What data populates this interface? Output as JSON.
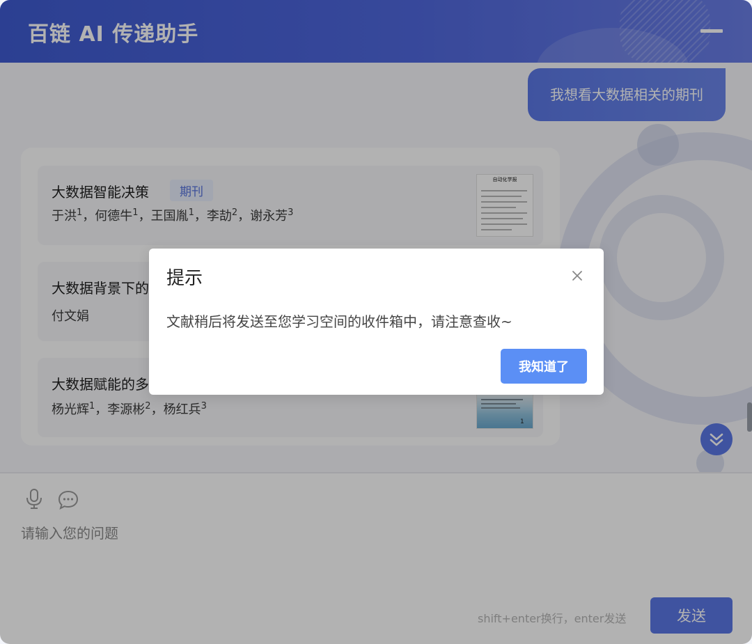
{
  "header": {
    "title": "百链 AI 传递助手",
    "minimize_icon": "minimize-icon"
  },
  "chat": {
    "user_message": "我想看大数据相关的期刊",
    "results": [
      {
        "title": "大数据智能决策",
        "tag": "期刊",
        "authors": [
          {
            "name": "于洪",
            "sup": "1"
          },
          {
            "name": "何德牛",
            "sup": "1"
          },
          {
            "name": "王国胤",
            "sup": "1"
          },
          {
            "name": "李劼",
            "sup": "2"
          },
          {
            "name": "谢永芳",
            "sup": "3"
          }
        ],
        "thumb_header": "自动化学报"
      },
      {
        "title": "大数据背景下的",
        "authors": [
          {
            "name": "付文娟",
            "sup": ""
          }
        ]
      },
      {
        "title": "大数据赋能的多",
        "authors": [
          {
            "name": "杨光辉",
            "sup": "1"
          },
          {
            "name": "李源彬",
            "sup": "2"
          },
          {
            "name": "杨红兵",
            "sup": "3"
          }
        ],
        "thumb_page": "1"
      }
    ],
    "author_separator": "，"
  },
  "input": {
    "placeholder": "请输入您的问题",
    "hint": "shift+enter换行，enter发送",
    "send_label": "发送"
  },
  "dialog": {
    "title": "提示",
    "message": "文献稍后将发送至您学习空间的收件箱中，请注意查收~",
    "ok_label": "我知道了"
  },
  "colors": {
    "header_start": "#3f5bd1",
    "accent": "#5b78e6",
    "dialog_button": "#5b8ff5",
    "tag_text": "#5673dd"
  }
}
